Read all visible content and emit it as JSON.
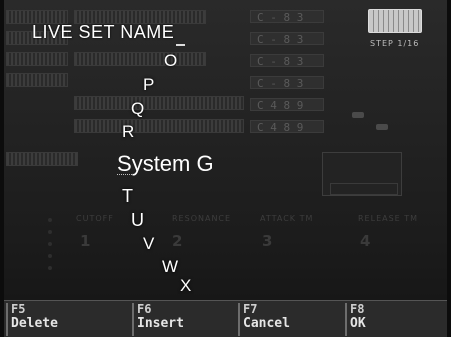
{
  "screen": {
    "title": "LIVE SET NAME",
    "step_text": "STEP 1/16"
  },
  "background_tracks": {
    "notes": [
      "C - 8 3",
      "C - 8 3",
      "C - 8 3",
      "C - 8 3",
      "C 4 8 9",
      "C 4 8 9"
    ]
  },
  "params": {
    "labels": [
      "CUTOFF",
      "RESONANCE",
      "ATTACK TM",
      "RELEASE TM"
    ],
    "numbers": [
      "1",
      "2",
      "3",
      "4"
    ]
  },
  "character_wheel": {
    "above": [
      "O",
      "P",
      "Q",
      "R"
    ],
    "selected_char": "S",
    "name_rest": "ystem G",
    "below": [
      "T",
      "U",
      "V",
      "W",
      "X"
    ]
  },
  "function_keys": [
    {
      "key": "F5",
      "label": "Delete"
    },
    {
      "key": "F6",
      "label": "Insert"
    },
    {
      "key": "F7",
      "label": "Cancel"
    },
    {
      "key": "F8",
      "label": "OK"
    }
  ],
  "icons": {
    "keyboard": "keyboard-icon"
  }
}
